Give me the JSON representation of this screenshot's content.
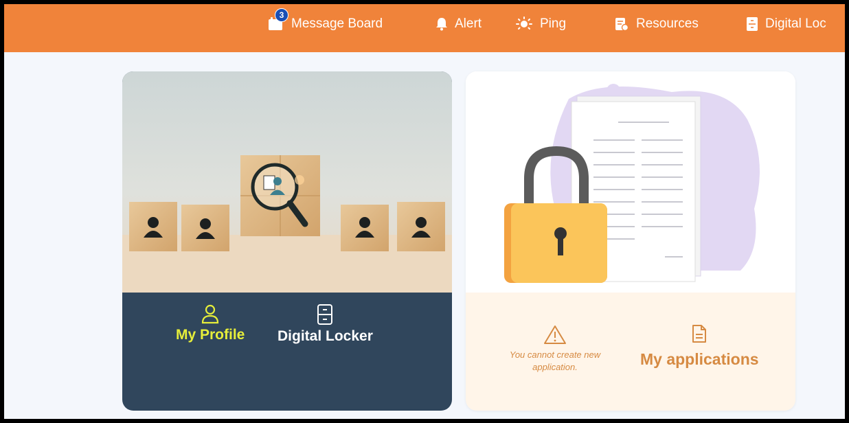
{
  "nav": {
    "message_board": "Message Board",
    "message_badge": "3",
    "alert": "Alert",
    "ping": "Ping",
    "resources": "Resources",
    "digital_locker": "Digital Loc"
  },
  "profile_card": {
    "my_profile": "My Profile",
    "digital_locker": "Digital Locker"
  },
  "applications_card": {
    "warning": "You cannot create new application.",
    "my_applications": "My applications"
  },
  "colors": {
    "topbar": "#f0833a",
    "profile_card": "#30465c",
    "highlight_text": "#e6ee3a",
    "applications_accent": "#d68a42"
  }
}
